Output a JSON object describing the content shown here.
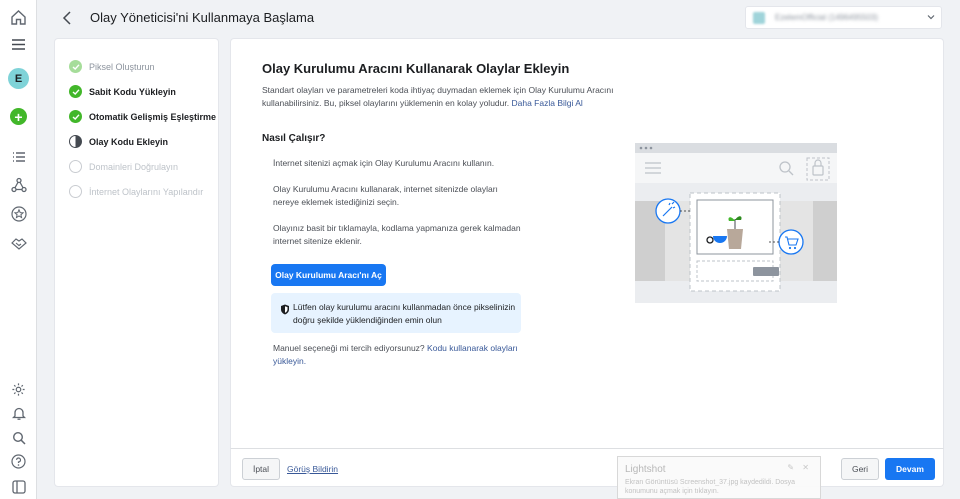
{
  "header": {
    "title": "Olay Yöneticisi'ni Kullanmaya Başlama",
    "account": "EzelemOfficial (1496495503)"
  },
  "rail": {
    "avatar_letter": "E",
    "plus": "+"
  },
  "steps": [
    {
      "label": "Piksel Oluşturun",
      "state": "done-light"
    },
    {
      "label": "Sabit Kodu Yükleyin",
      "state": "done"
    },
    {
      "label": "Otomatik Gelişmiş Eşleştirme",
      "state": "done"
    },
    {
      "label": "Olay Kodu Ekleyin",
      "state": "current"
    },
    {
      "label": "Domainleri Doğrulayın",
      "state": "todo"
    },
    {
      "label": "İnternet Olaylarını Yapılandır",
      "state": "todo"
    }
  ],
  "main": {
    "heading": "Olay Kurulumu Aracını Kullanarak Olaylar Ekleyin",
    "description": "Standart olayları ve parametreleri koda ihtiyaç duymadan eklemek için Olay Kurulumu Aracını kullanabilirsiniz. Bu, piksel olaylarını yüklemenin en kolay yoludur.",
    "learn_more": "Daha Fazla Bilgi Al",
    "how_title": "Nasıl Çalışır?",
    "how_steps": [
      "İnternet sitenizi açmak için Olay Kurulumu Aracını kullanın.",
      "Olay Kurulumu Aracını kullanarak, internet sitenizde olayları nereye eklemek istediğinizi seçin.",
      "Olayınız basit bir tıklamayla, kodlama yapmanıza gerek kalmadan internet sitenize eklenir."
    ],
    "open_button": "Olay Kurulumu Aracı'nı Aç",
    "notice": "Lütfen olay kurulumu aracını kullanmadan önce pikselinizin doğru şekilde yüklendiğinden emin olun",
    "manual_prefix": "Manuel seçeneği mi tercih ediyorsunuz?",
    "manual_link": "Kodu kullanarak olayları yükleyin."
  },
  "footer": {
    "cancel": "İptal",
    "feedback": "Görüş Bildirin",
    "back": "Geri",
    "next": "Devam"
  },
  "toast": {
    "title": "Lightshot",
    "text": "Ekran Görüntüsü Screenshot_37.jpg kaydedildi. Dosya konumunu açmak için tıklayın."
  },
  "colors": {
    "primary": "#1877f2",
    "success": "#42b72a",
    "link": "#385898",
    "notice_bg": "#e7f3ff"
  }
}
